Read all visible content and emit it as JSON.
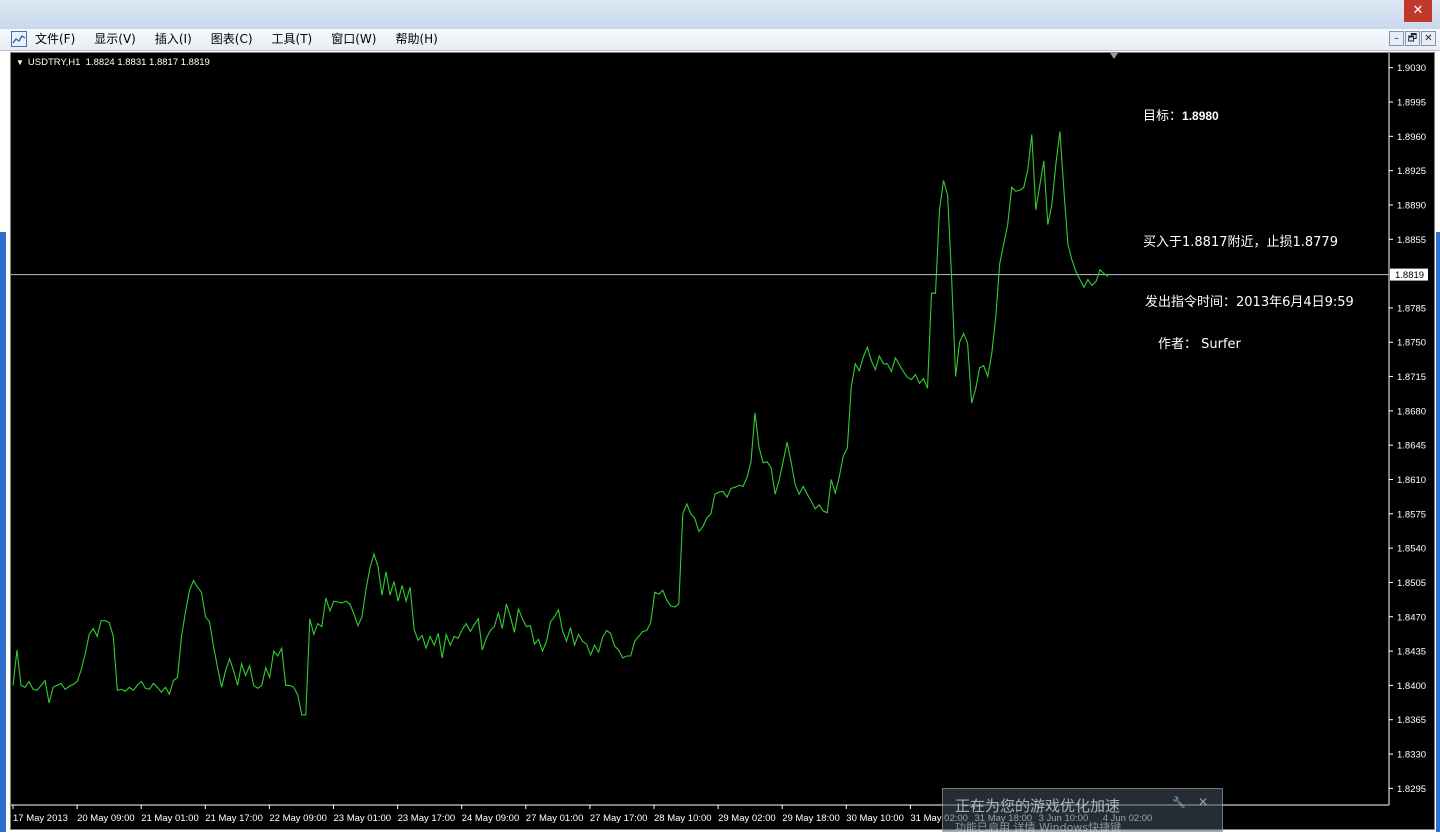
{
  "titlebar": {
    "close_glyph": "✕"
  },
  "menu": {
    "items": [
      "文件(F)",
      "显示(V)",
      "插入(I)",
      "图表(C)",
      "工具(T)",
      "窗口(W)",
      "帮助(H)"
    ],
    "window_buttons": [
      "–",
      "🗗",
      "✕"
    ]
  },
  "chart_header": {
    "symbol": "USDTRY,H1",
    "ohlc": "1.8824 1.8831 1.8817 1.8819"
  },
  "annotations": {
    "target_label": "目标：",
    "target_value": "1.8980",
    "buy": "买入于1.8817附近，止损1.8779",
    "time": "发出指令时间：2013年6月4日9:59",
    "author": "作者： Surfer"
  },
  "notification": {
    "title": "正在为您的游戏优化加速",
    "subtitle": "功能已启用 详情   Windows快捷键"
  },
  "colors": {
    "background": "#000000",
    "line": "#32cd32",
    "grid_text": "#ffffff",
    "current_price_line": "#c0c0c0"
  },
  "chart_data": {
    "type": "line",
    "symbol": "USDTRY",
    "timeframe": "H1",
    "current_price": 1.8819,
    "ylim": [
      1.8278,
      1.9045
    ],
    "y_ticks": [
      "1.9030",
      "1.8995",
      "1.8960",
      "1.8925",
      "1.8890",
      "1.8855",
      "1.8819",
      "1.8785",
      "1.8750",
      "1.8715",
      "1.8680",
      "1.8645",
      "1.8610",
      "1.8575",
      "1.8540",
      "1.8505",
      "1.8470",
      "1.8435",
      "1.8400",
      "1.8365",
      "1.8330",
      "1.8295"
    ],
    "x_ticks": [
      "17 May 2013",
      "20 May 09:00",
      "21 May 01:00",
      "21 May 17:00",
      "22 May 09:00",
      "23 May 01:00",
      "23 May 17:00",
      "24 May 09:00",
      "27 May 01:00",
      "27 May 17:00",
      "28 May 10:00",
      "29 May 02:00",
      "29 May 18:00",
      "30 May 10:00",
      "31 May 02:00",
      "31 May 18:00",
      "3 Jun 10:00",
      "4 Jun 02:00"
    ],
    "series": [
      {
        "values": [
          1.84,
          1.8436,
          1.84,
          1.8398,
          1.8404,
          1.8396,
          1.8395,
          1.84,
          1.8405,
          1.8382,
          1.8398,
          1.84,
          1.8402,
          1.8396,
          1.8399,
          1.8401,
          1.8404,
          1.8416,
          1.8432,
          1.8452,
          1.8458,
          1.845,
          1.8466,
          1.8466,
          1.8464,
          1.845,
          1.8395,
          1.8396,
          1.8394,
          1.8398,
          1.8395,
          1.84,
          1.8404,
          1.8397,
          1.8396,
          1.8402,
          1.8398,
          1.8393,
          1.8398,
          1.8391,
          1.8405,
          1.8408,
          1.845,
          1.8475,
          1.8497,
          1.8507,
          1.85,
          1.8495,
          1.847,
          1.8465,
          1.844,
          1.8418,
          1.8398,
          1.8415,
          1.8427,
          1.8415,
          1.84,
          1.8422,
          1.841,
          1.842,
          1.84,
          1.8397,
          1.84,
          1.8418,
          1.8408,
          1.8435,
          1.843,
          1.8438,
          1.84,
          1.84,
          1.8398,
          1.839,
          1.837,
          1.837,
          1.8468,
          1.8452,
          1.8463,
          1.846,
          1.8489,
          1.8476,
          1.8486,
          1.8485,
          1.8484,
          1.8486,
          1.8483,
          1.8473,
          1.8461,
          1.847,
          1.8498,
          1.852,
          1.8534,
          1.8521,
          1.8492,
          1.8516,
          1.8492,
          1.8506,
          1.8486,
          1.8502,
          1.8486,
          1.85,
          1.8457,
          1.8446,
          1.8451,
          1.8438,
          1.845,
          1.8441,
          1.8453,
          1.8428,
          1.8452,
          1.8441,
          1.845,
          1.8448,
          1.8457,
          1.8463,
          1.8455,
          1.8462,
          1.8468,
          1.8436,
          1.8448,
          1.8456,
          1.846,
          1.8474,
          1.8458,
          1.8483,
          1.847,
          1.8454,
          1.8478,
          1.8468,
          1.846,
          1.8461,
          1.8442,
          1.8447,
          1.8435,
          1.8445,
          1.8465,
          1.847,
          1.8477,
          1.8456,
          1.8445,
          1.8459,
          1.8441,
          1.8452,
          1.8445,
          1.8442,
          1.8431,
          1.8441,
          1.8434,
          1.8449,
          1.8456,
          1.8453,
          1.844,
          1.8436,
          1.8428,
          1.843,
          1.843,
          1.8445,
          1.845,
          1.8455,
          1.8456,
          1.8464,
          1.8495,
          1.8493,
          1.8497,
          1.8487,
          1.8481,
          1.848,
          1.8483,
          1.8575,
          1.8585,
          1.8575,
          1.857,
          1.8557,
          1.8562,
          1.8571,
          1.8575,
          1.8595,
          1.8597,
          1.8598,
          1.8592,
          1.8601,
          1.8602,
          1.8604,
          1.8603,
          1.8612,
          1.8628,
          1.8678,
          1.8643,
          1.8627,
          1.8628,
          1.8622,
          1.8595,
          1.8609,
          1.8628,
          1.8648,
          1.8628,
          1.8605,
          1.8595,
          1.8603,
          1.8595,
          1.8588,
          1.858,
          1.8584,
          1.8578,
          1.8576,
          1.861,
          1.8596,
          1.8613,
          1.8634,
          1.8642,
          1.8705,
          1.8728,
          1.8721,
          1.8735,
          1.8745,
          1.8731,
          1.8722,
          1.8736,
          1.8728,
          1.8728,
          1.872,
          1.8734,
          1.8727,
          1.872,
          1.8714,
          1.8712,
          1.8717,
          1.8708,
          1.8713,
          1.8703,
          1.88,
          1.88,
          1.8885,
          1.8915,
          1.89,
          1.8816,
          1.8715,
          1.875,
          1.8759,
          1.8749,
          1.8688,
          1.8702,
          1.8724,
          1.8726,
          1.8715,
          1.8738,
          1.8775,
          1.883,
          1.885,
          1.887,
          1.8908,
          1.8904,
          1.8905,
          1.8908,
          1.8926,
          1.8962,
          1.8885,
          1.891,
          1.8935,
          1.887,
          1.889,
          1.8932,
          1.8965,
          1.8905,
          1.885,
          1.8834,
          1.8822,
          1.8814,
          1.8806,
          1.8814,
          1.8808,
          1.8812,
          1.8824,
          1.882,
          1.8817
        ]
      }
    ],
    "title": "",
    "xlabel": "",
    "ylabel": "",
    "grid": false
  }
}
